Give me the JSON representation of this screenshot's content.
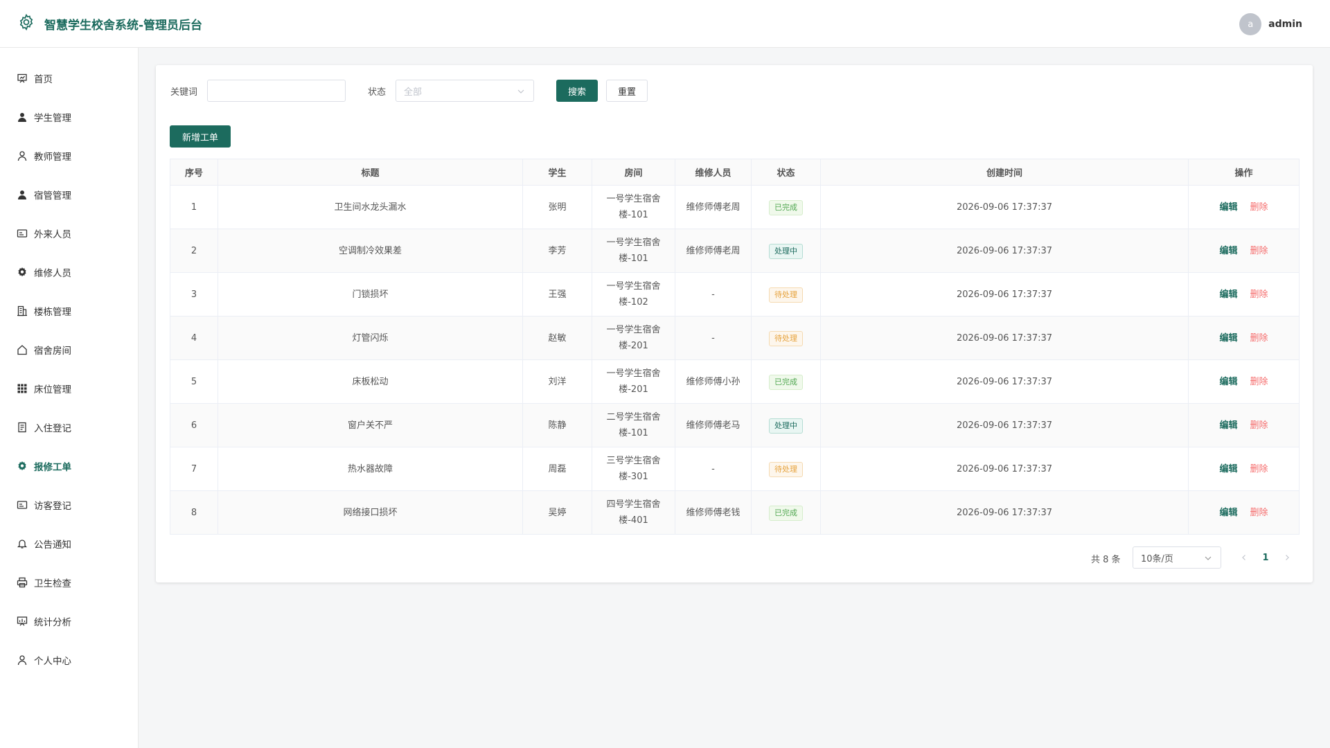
{
  "header": {
    "title": "智慧学生校舍系统-管理员后台",
    "avatar_letter": "a",
    "username": "admin"
  },
  "sidebar": {
    "items": [
      {
        "label": "首页",
        "icon": "dashboard-icon"
      },
      {
        "label": "学生管理",
        "icon": "user-filled-icon"
      },
      {
        "label": "教师管理",
        "icon": "user-icon"
      },
      {
        "label": "宿管管理",
        "icon": "user-filled-icon"
      },
      {
        "label": "外来人员",
        "icon": "id-card-icon"
      },
      {
        "label": "维修人员",
        "icon": "gear-icon"
      },
      {
        "label": "楼栋管理",
        "icon": "building-icon"
      },
      {
        "label": "宿舍房间",
        "icon": "house-icon"
      },
      {
        "label": "床位管理",
        "icon": "grid-icon"
      },
      {
        "label": "入住登记",
        "icon": "document-icon"
      },
      {
        "label": "报修工单",
        "icon": "gear-icon"
      },
      {
        "label": "访客登记",
        "icon": "id-card-icon"
      },
      {
        "label": "公告通知",
        "icon": "bell-icon"
      },
      {
        "label": "卫生检查",
        "icon": "printer-icon"
      },
      {
        "label": "统计分析",
        "icon": "chart-board-icon"
      },
      {
        "label": "个人中心",
        "icon": "user-icon"
      }
    ],
    "active_index": 10
  },
  "filters": {
    "keyword_label": "关键词",
    "keyword_value": "",
    "status_label": "状态",
    "status_value": "全部",
    "search_label": "搜索",
    "reset_label": "重置"
  },
  "toolbar": {
    "add_label": "新增工单"
  },
  "table": {
    "columns": [
      "序号",
      "标题",
      "学生",
      "房间",
      "维修人员",
      "状态",
      "创建时间",
      "操作"
    ],
    "edit_label": "编辑",
    "delete_label": "删除",
    "rows": [
      {
        "no": "1",
        "title": "卫生间水龙头漏水",
        "student": "张明",
        "room_line1": "一号学生宿舍",
        "room_line2": "楼-101",
        "worker": "维修师傅老周",
        "status": "已完成",
        "status_type": "done",
        "time": "2026-09-06 17:37:37"
      },
      {
        "no": "2",
        "title": "空调制冷效果差",
        "student": "李芳",
        "room_line1": "一号学生宿舍",
        "room_line2": "楼-101",
        "worker": "维修师傅老周",
        "status": "处理中",
        "status_type": "doing",
        "time": "2026-09-06 17:37:37"
      },
      {
        "no": "3",
        "title": "门锁损坏",
        "student": "王强",
        "room_line1": "一号学生宿舍",
        "room_line2": "楼-102",
        "worker": "-",
        "status": "待处理",
        "status_type": "todo",
        "time": "2026-09-06 17:37:37"
      },
      {
        "no": "4",
        "title": "灯管闪烁",
        "student": "赵敏",
        "room_line1": "一号学生宿舍",
        "room_line2": "楼-201",
        "worker": "-",
        "status": "待处理",
        "status_type": "todo",
        "time": "2026-09-06 17:37:37"
      },
      {
        "no": "5",
        "title": "床板松动",
        "student": "刘洋",
        "room_line1": "一号学生宿舍",
        "room_line2": "楼-201",
        "worker": "维修师傅小孙",
        "status": "已完成",
        "status_type": "done",
        "time": "2026-09-06 17:37:37"
      },
      {
        "no": "6",
        "title": "窗户关不严",
        "student": "陈静",
        "room_line1": "二号学生宿舍",
        "room_line2": "楼-101",
        "worker": "维修师傅老马",
        "status": "处理中",
        "status_type": "doing",
        "time": "2026-09-06 17:37:37"
      },
      {
        "no": "7",
        "title": "热水器故障",
        "student": "周磊",
        "room_line1": "三号学生宿舍",
        "room_line2": "楼-301",
        "worker": "-",
        "status": "待处理",
        "status_type": "todo",
        "time": "2026-09-06 17:37:37"
      },
      {
        "no": "8",
        "title": "网络接口损坏",
        "student": "吴婷",
        "room_line1": "四号学生宿舍",
        "room_line2": "楼-401",
        "worker": "维修师傅老钱",
        "status": "已完成",
        "status_type": "done",
        "time": "2026-09-06 17:37:37"
      }
    ]
  },
  "pagination": {
    "total_text": "共 8 条",
    "page_size": "10条/页",
    "current_page": "1"
  },
  "colors": {
    "primary": "#1c6b5e",
    "danger": "#f56c6c",
    "success": "#52a853",
    "warning": "#e6a23c"
  }
}
